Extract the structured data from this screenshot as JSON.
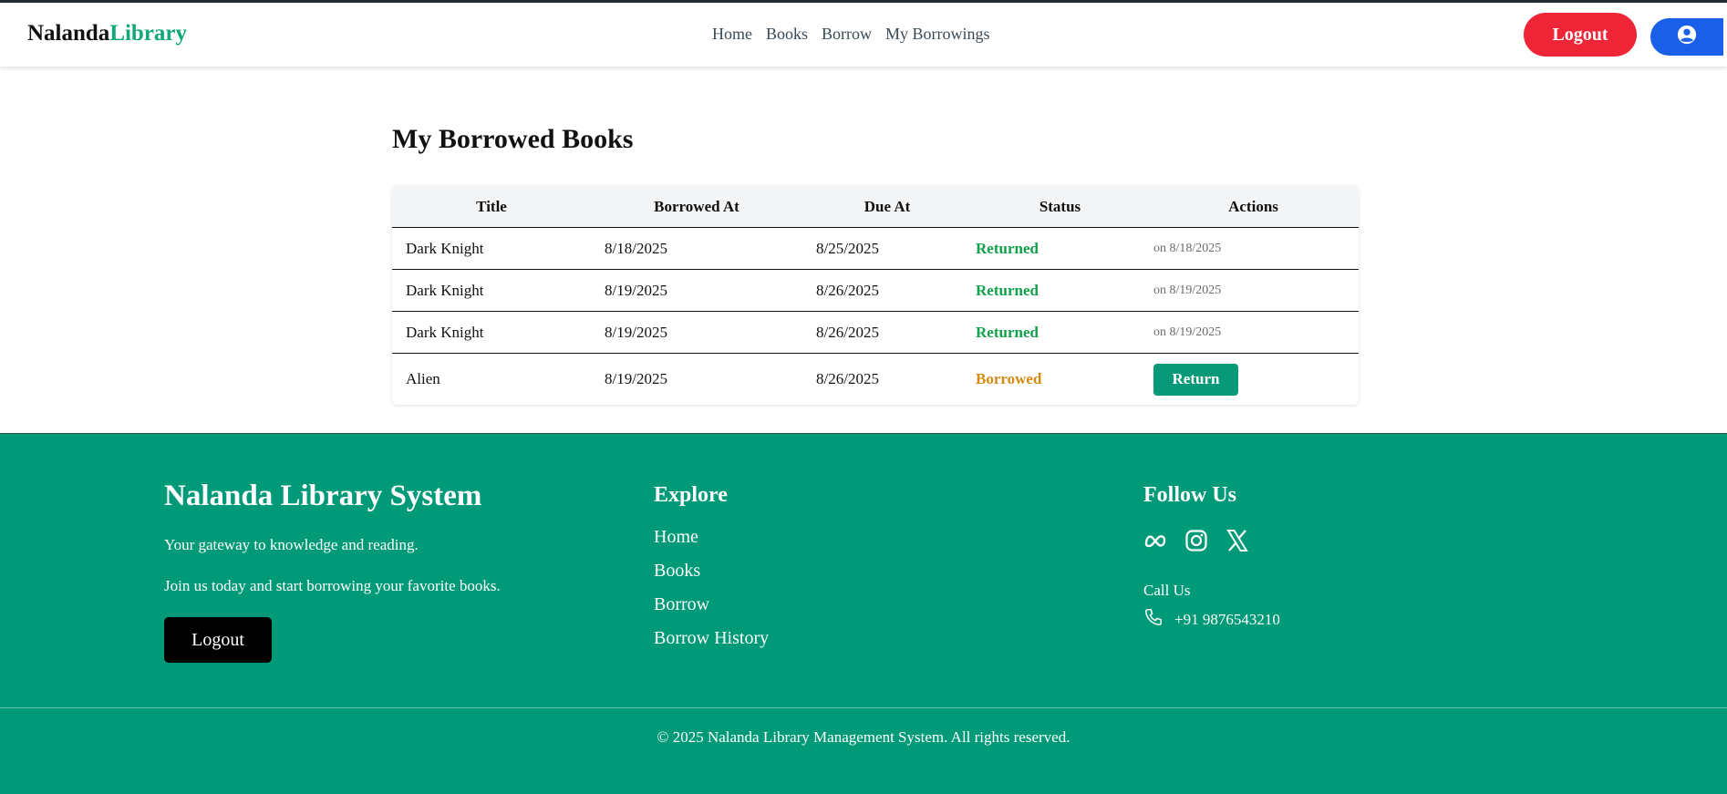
{
  "header": {
    "brand_part1": "Nalanda",
    "brand_part2": "Library",
    "nav": [
      "Home",
      "Books",
      "Borrow",
      "My Borrowings"
    ],
    "logout_label": "Logout",
    "user_icon": "user-circle-icon"
  },
  "main": {
    "title": "My Borrowed Books",
    "columns": [
      "Title",
      "Borrowed At",
      "Due At",
      "Status",
      "Actions"
    ],
    "rows": [
      {
        "title": "Dark Knight",
        "borrowed_at": "8/18/2025",
        "due_at": "8/25/2025",
        "status": "Returned",
        "action": "on 8/18/2025"
      },
      {
        "title": "Dark Knight",
        "borrowed_at": "8/19/2025",
        "due_at": "8/26/2025",
        "status": "Returned",
        "action": "on 8/19/2025"
      },
      {
        "title": "Dark Knight",
        "borrowed_at": "8/19/2025",
        "due_at": "8/26/2025",
        "status": "Returned",
        "action": "on 8/19/2025"
      },
      {
        "title": "Alien",
        "borrowed_at": "8/19/2025",
        "due_at": "8/26/2025",
        "status": "Borrowed",
        "action": "Return"
      }
    ]
  },
  "footer": {
    "brand": "Nalanda Library System",
    "tagline1": "Your gateway to knowledge and reading.",
    "tagline2": "Join us today and start borrowing your favorite books.",
    "logout_label": "Logout",
    "explore_title": "Explore",
    "explore_links": [
      "Home",
      "Books",
      "Borrow",
      "Borrow History"
    ],
    "follow_title": "Follow Us",
    "social_icons": [
      "meta-icon",
      "instagram-icon",
      "x-icon"
    ],
    "call_title": "Call Us",
    "phone": "+91 9876543210",
    "copyright": "© 2025 Nalanda Library Management System. All rights reserved."
  },
  "colors": {
    "accent": "#12a87a",
    "footer_bg": "#009a78",
    "logout_red": "#ee2536",
    "user_blue": "#1a5fe8",
    "returned_green": "#12a14b",
    "borrowed_orange": "#d58a0f"
  }
}
